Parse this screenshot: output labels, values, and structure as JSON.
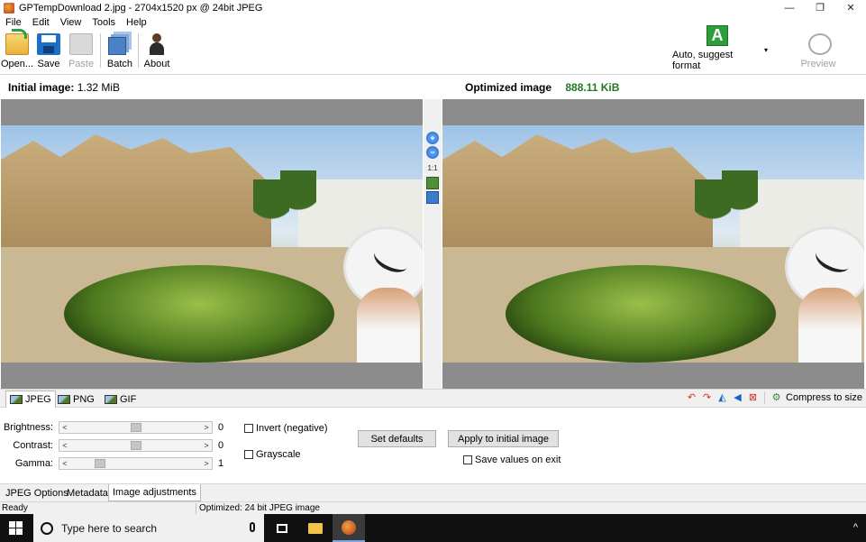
{
  "window": {
    "title": "GPTempDownload 2.jpg - 2704x1520 px @ 24bit JPEG",
    "minimize": "—",
    "maximize": "❐",
    "close": "✕"
  },
  "menu": [
    "File",
    "Edit",
    "View",
    "Tools",
    "Help"
  ],
  "toolbar": {
    "open": "Open...",
    "save": "Save",
    "paste": "Paste",
    "batch": "Batch",
    "about": "About",
    "format_letter": "A",
    "format_label": "Auto, suggest format",
    "format_arrow": "▾",
    "preview": "Preview"
  },
  "info": {
    "initial_label": "Initial image:",
    "initial_size": "1.32 MiB",
    "optimized_label": "Optimized image",
    "optimized_size": "888.11 KiB"
  },
  "zoom_tools": [
    "zoom-in-icon",
    "zoom-out-icon",
    "actual-size-icon",
    "fit-window-icon",
    "fit-screen-icon"
  ],
  "zoom_actual_label": "1:1",
  "format_tabs": [
    "JPEG",
    "PNG",
    "GIF"
  ],
  "right_tools": {
    "compress_label": "Compress to size",
    "icons": [
      "rotate-left-icon",
      "rotate-right-icon",
      "flip-vertical-icon",
      "flip-horizontal-icon",
      "crop-icon",
      "compress-icon"
    ]
  },
  "adjustments": {
    "brightness": {
      "label": "Brightness:",
      "value": "0",
      "level": 0.5
    },
    "contrast": {
      "label": "Contrast:",
      "value": "0",
      "level": 0.5
    },
    "gamma": {
      "label": "Gamma:",
      "value": "1",
      "level": 0.2
    },
    "invert": "Invert (negative)",
    "grayscale": "Grayscale",
    "set_defaults": "Set defaults",
    "apply": "Apply to initial image",
    "save_values": "Save values on exit"
  },
  "bottom_tabs": [
    "JPEG Options",
    "Metadata",
    "Image adjustments"
  ],
  "status": {
    "ready": "Ready",
    "optimized": "Optimized: 24 bit JPEG image"
  },
  "taskbar": {
    "search_placeholder": "Type here to search",
    "tray_arrow": "^"
  }
}
